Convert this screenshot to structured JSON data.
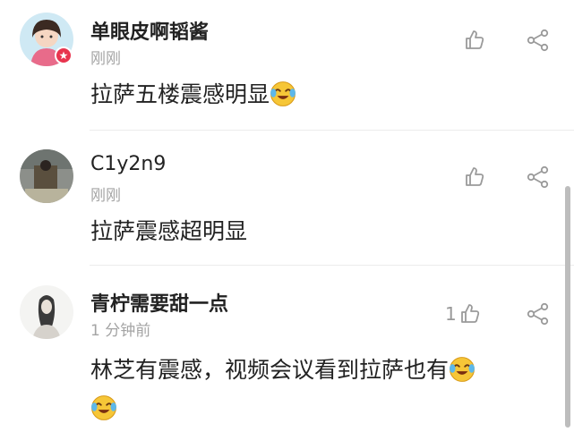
{
  "comments": [
    {
      "username": "单眼皮啊韬酱",
      "time": "刚刚",
      "text": "拉萨五楼震感明显",
      "like_count": "",
      "emoji": "laughing-crying-emoji"
    },
    {
      "username": "C1y2n9",
      "time": "刚刚",
      "text": "拉萨震感超明显",
      "like_count": ""
    },
    {
      "username": "青柠需要甜一点",
      "time": "1 分钟前",
      "text": "林芝有震感，视频会议看到拉萨也有",
      "like_count": "1",
      "emoji": "laughing-crying-emoji"
    }
  ],
  "icons": {
    "like": "thumbs-up-icon",
    "share": "share-icon",
    "badge": "star-badge-icon"
  },
  "colors": {
    "text": "#222222",
    "meta": "#a4a4a4",
    "badge": "#e8344e",
    "emoji": "#f5c43a"
  }
}
